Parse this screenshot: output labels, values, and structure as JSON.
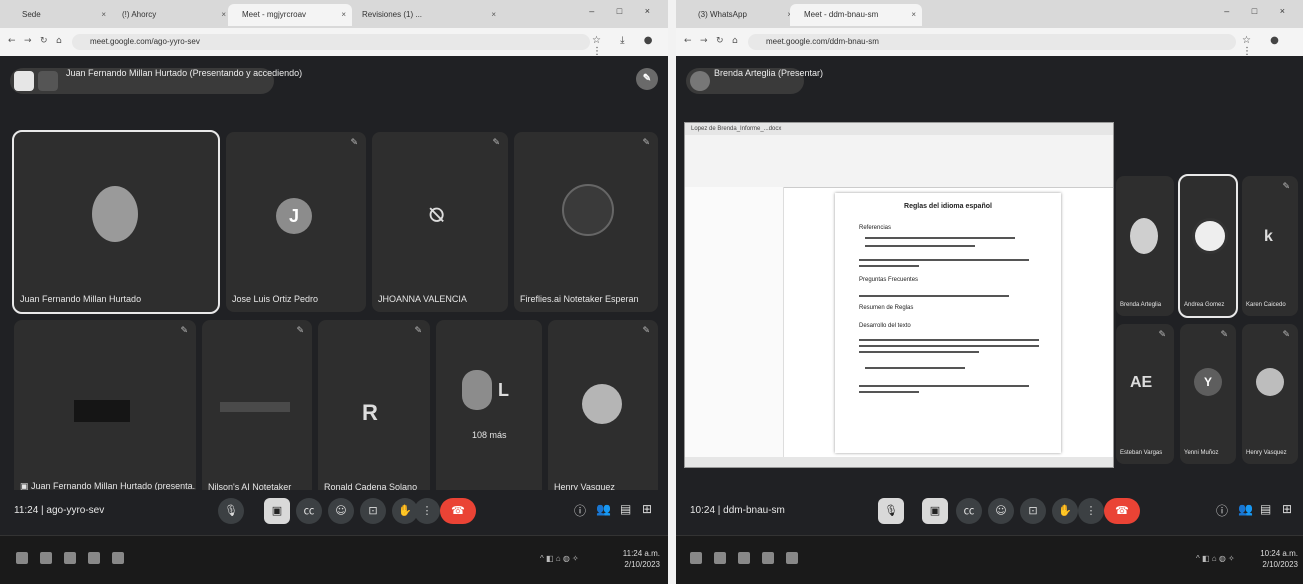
{
  "left": {
    "tabs": [
      "Sede",
      "(!) Ahorcy",
      "Meet - mgjyrcroav",
      "Revisiones (1) ..."
    ],
    "url": "meet.google.com/ago-yyro-sev",
    "presenter_bar": "Juan Fernando Millan Hurtado (Presentando y accediendo)",
    "tiles": [
      {
        "name": "Juan Fernando Millan Hurtado",
        "avatar": "",
        "selected": true
      },
      {
        "name": "Jose Luis Ortiz Pedro",
        "avatar": "J"
      },
      {
        "name": "JHOANNA VALENCIA",
        "avatar": ""
      },
      {
        "name": "Fireflies.ai Notetaker Esperan",
        "avatar": ""
      },
      {
        "name": "Juan Fernando Millan Hurtado (presenta...",
        "avatar": ""
      },
      {
        "name": "Nilson's AI Notetaker",
        "avatar": ""
      },
      {
        "name": "Ronald Cadena Solano",
        "avatar": "R"
      },
      {
        "name": "",
        "avatar": "L",
        "more": "108 más"
      },
      {
        "name": "Henry Vasquez",
        "avatar": ""
      }
    ],
    "meeting_code": "11:24 | ago-yyro-sev",
    "clock": [
      "11:24 a.m.",
      "2/10/2023"
    ]
  },
  "right": {
    "tabs": [
      "(3) WhatsApp",
      "Meet - ddm-bnau-sm"
    ],
    "url": "meet.google.com/ddm-bnau-sm",
    "presenter_bar": "Brenda Arteglia (Presentar)",
    "doc_title": "Lopez de Brenda_Informe_...docx",
    "doc_heading": "Reglas del idioma español",
    "doc_lines": [
      "Referencias",
      "Preguntas Frecuentes",
      "Resumen de Reglas",
      "Desarrollo del texto"
    ],
    "participants": [
      {
        "name": "Brenda Arteglia",
        "avatar": ""
      },
      {
        "name": "Andrea Gomez",
        "avatar": ""
      },
      {
        "name": "Karen Caicedo",
        "avatar": "k"
      },
      {
        "name": "Esteban Vargas",
        "avatar": "AE"
      },
      {
        "name": "Yenni Muñoz",
        "avatar": "Y"
      },
      {
        "name": "Henry Vasquez",
        "avatar": ""
      }
    ],
    "meeting_code": "10:24 | ddm-bnau-sm",
    "clock": [
      "10:24 a.m.",
      "2/10/2023"
    ]
  }
}
